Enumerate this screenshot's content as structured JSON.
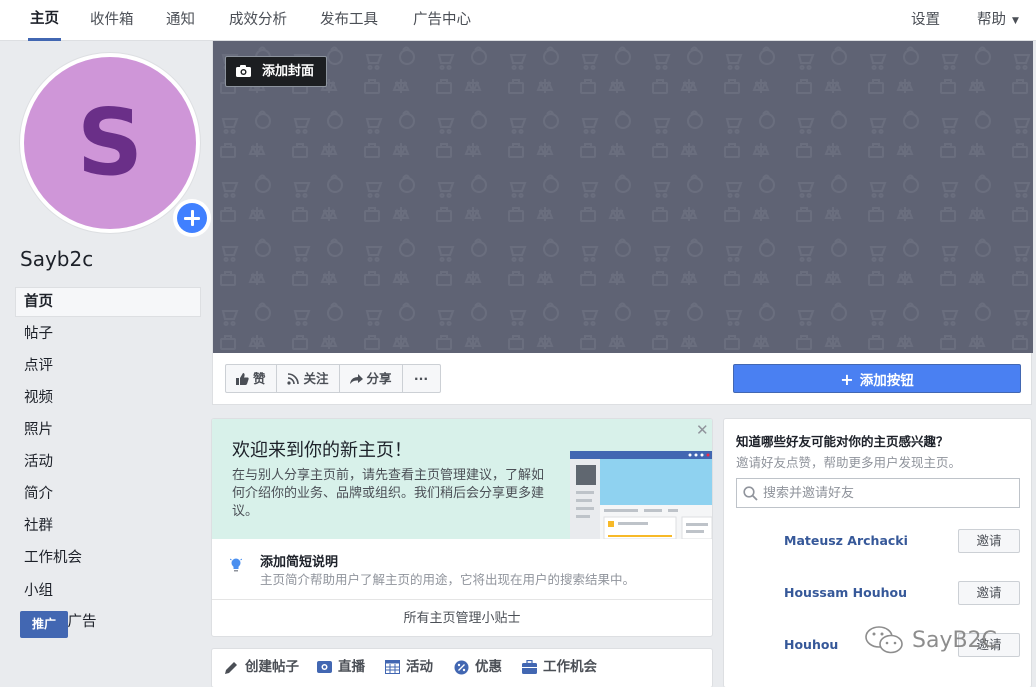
{
  "nav": {
    "tabs": [
      "主页",
      "收件箱",
      "通知",
      "成效分析",
      "发布工具",
      "广告中心"
    ],
    "settings": "设置",
    "help": "帮助"
  },
  "sidebar": {
    "avatar_letter": "S",
    "page_name": "Sayb2c",
    "items": [
      "首页",
      "帖子",
      "点评",
      "视频",
      "照片",
      "活动",
      "简介",
      "社群",
      "工作机会",
      "小组",
      "信息与广告"
    ],
    "promote": "推广"
  },
  "cover": {
    "add_cover": "添加封面"
  },
  "actions": {
    "like": "赞",
    "follow": "关注",
    "share": "分享",
    "more": "···",
    "add_button": "添加按钮"
  },
  "welcome": {
    "title": "欢迎来到你的新主页！",
    "text": "在与别人分享主页前，请先查看主页管理建议，了解如何介绍你的业务、品牌或组织。我们稍后会分享更多建议。",
    "tip_title": "添加简短说明",
    "tip_desc": "主页简介帮助用户了解主页的用途，它将出现在用户的搜索结果中。",
    "all_tips": "所有主页管理小贴士"
  },
  "create": {
    "post": "创建帖子",
    "live": "直播",
    "event": "活动",
    "offer": "优惠",
    "job": "工作机会"
  },
  "invite": {
    "title": "知道哪些好友可能对你的主页感兴趣？",
    "subtitle": "邀请好友点赞，帮助更多用户发现主页。",
    "search_placeholder": "搜索并邀请好友",
    "friends": [
      {
        "name": "Mateusz Archacki",
        "button": "邀请"
      },
      {
        "name": "Houssam Houhou",
        "button": "邀请"
      },
      {
        "name": "Houhou",
        "button": "邀请"
      }
    ]
  },
  "watermark": "SayB2C",
  "colors": {
    "accent": "#4267b2",
    "primary_button": "#4a80f2",
    "cover": "#5f6374",
    "avatar_bg": "#cf96d8",
    "avatar_letter": "#6a2f88",
    "welcome_bg": "#d8f1ea"
  }
}
